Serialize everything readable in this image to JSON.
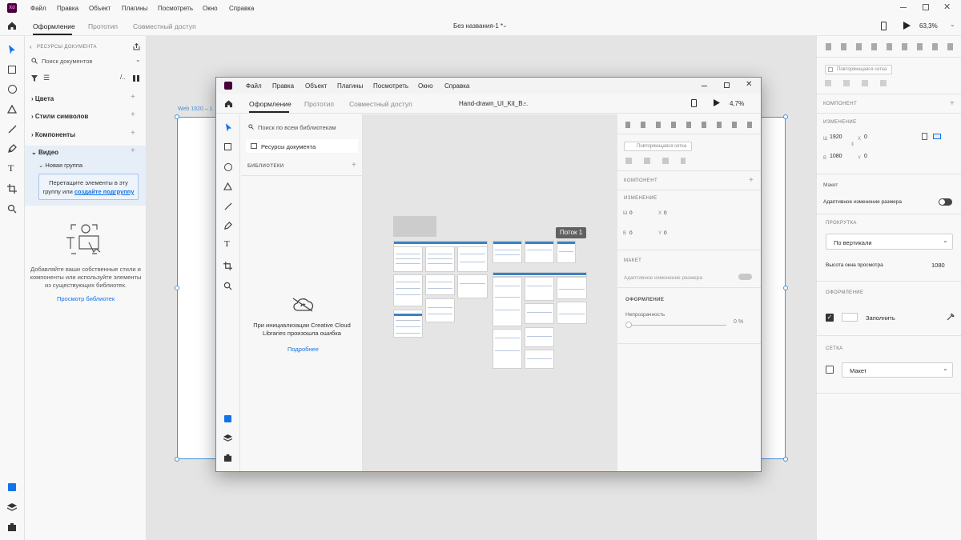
{
  "app": {
    "name": "Xd",
    "accent": "#470137",
    "selection_color": "#4a90d9"
  },
  "menu": [
    "Файл",
    "Правка",
    "Объект",
    "Плагины",
    "Посмотреть",
    "Окно",
    "Справка"
  ],
  "tabs": [
    "Оформление",
    "Прототип",
    "Совместный доступ"
  ],
  "doc_title": "Без названия-1 *",
  "zoom": "63,3%",
  "left": {
    "header": "РЕСУРСЫ ДОКУМЕНТА",
    "search_placeholder": "Поиск документов",
    "sections": [
      "Цвета",
      "Стили символов",
      "Компоненты",
      "Видео"
    ],
    "group": "Новая группа",
    "drop_hint_1": "Перетащите элементы в эту",
    "drop_hint_2": "группу или",
    "drop_link": "создайте подгруппу",
    "empty_text": "Добавляйте ваши собственные стили и компоненты или используйте элементы из существующих библиотек.",
    "view_libs": "Просмотр библиотек"
  },
  "artboard": {
    "label": "Web 1920 – 1"
  },
  "right": {
    "repeat_grid": "Повторяющаяся сетка",
    "component": "КОМПОНЕНТ",
    "transform": "ИЗМЕНЕНИЕ",
    "w": "1920",
    "h": "1080",
    "x": "0",
    "y": "0",
    "w_label": "Ш",
    "h_label": "В",
    "x_label": "X",
    "y_label": "Y",
    "layout": "Макет",
    "responsive": "Адаптивное изменение размера",
    "scroll": "ПРОКРУТКА",
    "scroll_value": "По вертикали",
    "viewport": "Высота окна просмотра",
    "viewport_value": "1080",
    "appearance": "ОФОРМЛЕНИЕ",
    "fill": "Заполнить",
    "grid": "СЕТКА",
    "grid_value": "Макет"
  },
  "inner": {
    "menu": [
      "Файл",
      "Правка",
      "Объект",
      "Плагины",
      "Посмотреть",
      "Окно",
      "Справка"
    ],
    "tabs": [
      "Оформление",
      "Прототип",
      "Совместный доступ"
    ],
    "doc_title": "Hand-drawn_UI_Kit_B...",
    "zoom": "4,7%",
    "search_placeholder": "Поиск по всем библиотекам",
    "doc_assets": "Ресурсы документа",
    "libraries": "БИБЛИОТЕКИ",
    "error": "При инициализации Creative Cloud Libraries произошла ошибка",
    "more": "Подробнее",
    "flow": "Поток 1",
    "r_repeat": "Повторяющаяся сетка",
    "r_component": "КОМПОНЕНТ",
    "r_transform": "ИЗМЕНЕНИЕ",
    "r_x": "0",
    "r_y": "0",
    "r_w": "0",
    "r_h": "0",
    "r_layout": "МАКЕТ",
    "r_responsive": "Адаптивное изменение размера",
    "r_appearance": "ОФОРМЛЕНИЕ",
    "r_opacity": "Непрозрачность",
    "r_opacity_val": "0 %",
    "r_w_label": "Ш",
    "r_h_label": "В",
    "r_x_label": "X",
    "r_y_label": "Y"
  }
}
